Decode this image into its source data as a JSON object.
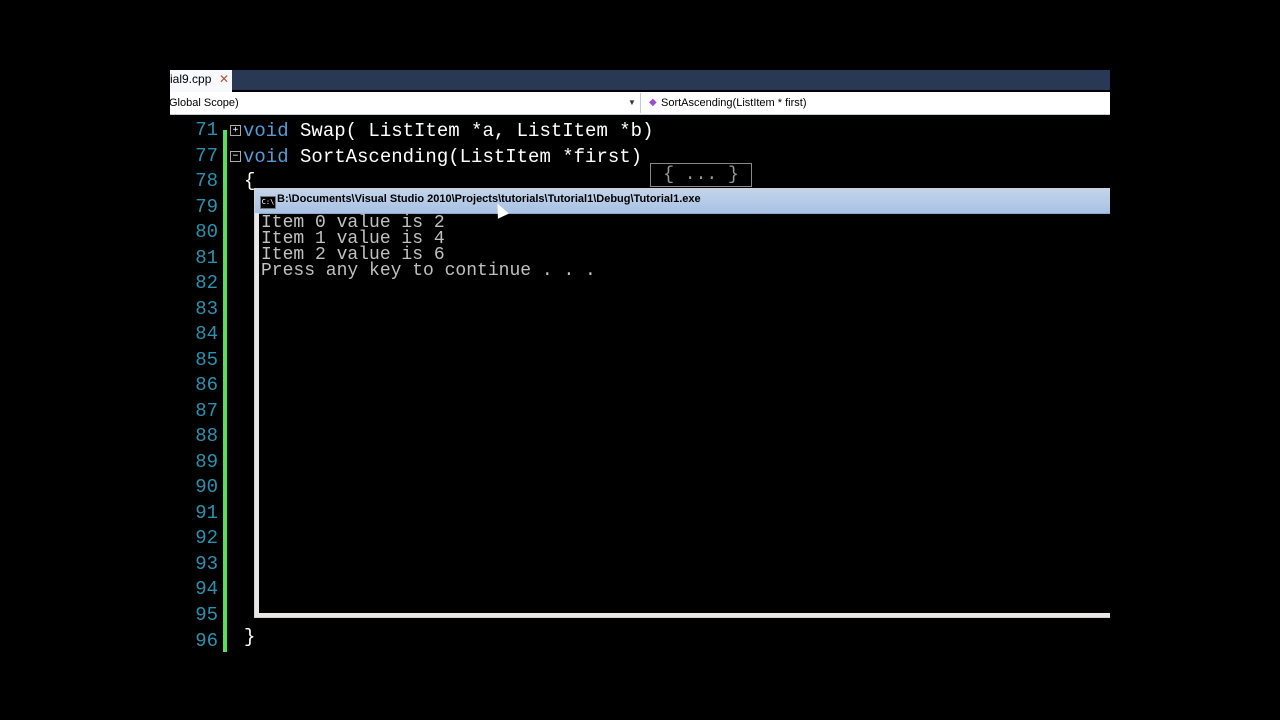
{
  "tab": {
    "label": "ial9.cpp",
    "close": "✕"
  },
  "navbar": {
    "scope": "Global Scope)",
    "member": "SortAscending(ListItem * first)"
  },
  "editor": {
    "line_numbers": [
      "71",
      "77",
      "78",
      "79",
      "80",
      "81",
      "82",
      "83",
      "84",
      "85",
      "86",
      "87",
      "88",
      "89",
      "90",
      "91",
      "92",
      "93",
      "94",
      "95",
      "96"
    ],
    "line71": {
      "kw": "void",
      "text": " Swap( ListItem *a, ListItem *b)",
      "collapsed": "{ ... }"
    },
    "line77": {
      "kw": "void",
      "text": " SortAscending(ListItem *first)"
    },
    "open_brace": "{",
    "close_brace": "}",
    "fold_plus": "+",
    "fold_minus": "−"
  },
  "console": {
    "title": "B:\\Documents\\Visual Studio 2010\\Projects\\tutorials\\Tutorial1\\Debug\\Tutorial1.exe",
    "icon": "C:\\",
    "lines": [
      "Item 0 value is 2",
      "Item 1 value is 4",
      "Item 2 value is 6",
      "Press any key to continue . . ."
    ]
  },
  "colors": {
    "keyword": "#569cd6",
    "line_number": "#2b91af",
    "change_bar": "#55e05a"
  }
}
